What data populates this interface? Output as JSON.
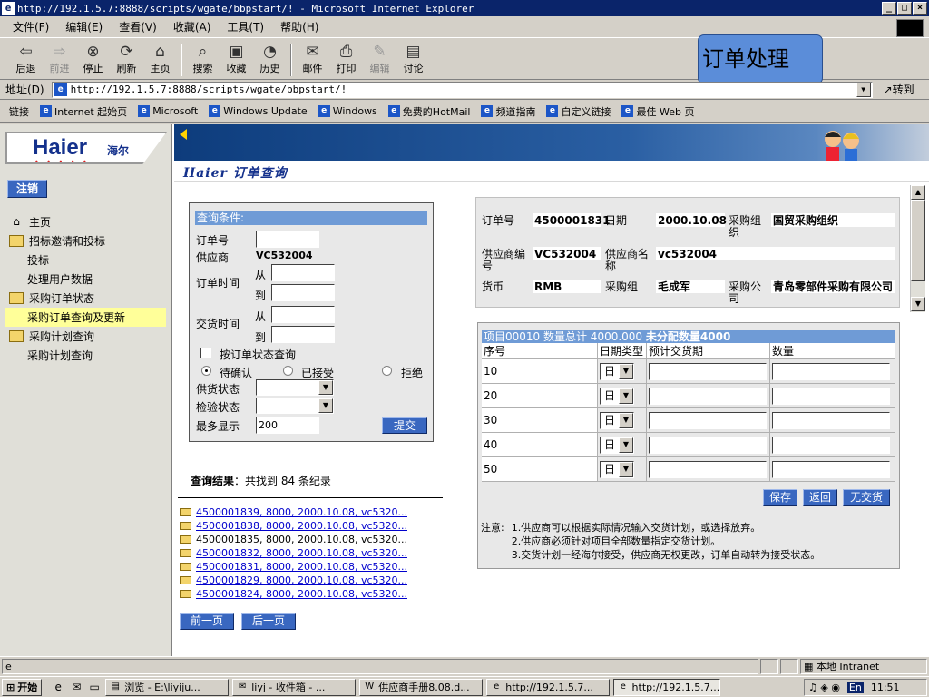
{
  "window": {
    "title": "http://192.1.5.7:8888/scripts/wgate/bbpstart/! - Microsoft Internet Explorer"
  },
  "menu": [
    "文件(F)",
    "编辑(E)",
    "查看(V)",
    "收藏(A)",
    "工具(T)",
    "帮助(H)"
  ],
  "toolbar": {
    "back": "后退",
    "forward": "前进",
    "stop": "停止",
    "refresh": "刷新",
    "home": "主页",
    "search": "搜索",
    "favorites": "收藏",
    "history": "历史",
    "mail": "邮件",
    "print": "打印",
    "edit": "编辑",
    "discuss": "讨论"
  },
  "overlay_label": "订单处理",
  "address": {
    "label": "地址(D)",
    "url": "http://192.1.5.7:8888/scripts/wgate/bbpstart/!",
    "go": "转到"
  },
  "links": {
    "label": "链接",
    "items": [
      "Internet 起始页",
      "Microsoft",
      "Windows Update",
      "Windows",
      "免费的HotMail",
      "频道指南",
      "自定义链接",
      "最佳 Web 页"
    ]
  },
  "brand": {
    "name": "Haier",
    "cn": "海尔"
  },
  "logout": "注销",
  "nav": [
    {
      "label": "主页",
      "kind": "home"
    },
    {
      "label": "招标邀请和投标",
      "kind": "folder"
    },
    {
      "label": "投标",
      "kind": "sub"
    },
    {
      "label": "处理用户数据",
      "kind": "sub"
    },
    {
      "label": "采购订单状态",
      "kind": "folder"
    },
    {
      "label": "采购订单查询及更新",
      "kind": "sub",
      "selected": true
    },
    {
      "label": "采购计划查询",
      "kind": "folder"
    },
    {
      "label": "采购计划查询",
      "kind": "sub"
    }
  ],
  "page_title": "Haier 订单查询",
  "query": {
    "header": "查询条件:",
    "order_no_label": "订单号",
    "supplier_label": "供应商",
    "supplier_value": "VC532004",
    "order_time_label": "订单时间",
    "from": "从",
    "to": "到",
    "delivery_time_label": "交货时间",
    "status_check_label": "按订单状态查询",
    "radio_pending": "待确认",
    "radio_accepted": "已接受",
    "radio_rejected": "拒绝",
    "supply_status_label": "供货状态",
    "inspect_status_label": "检验状态",
    "max_label": "最多显示",
    "max_value": "200",
    "submit": "提交"
  },
  "results": {
    "label": "查询结果",
    "summary": "：共找到 84 条纪录",
    "items": [
      {
        "text": "4500001839, 8000, 2000.10.08, vc5320...",
        "link": true
      },
      {
        "text": "4500001838, 8000, 2000.10.08, vc5320...",
        "link": true
      },
      {
        "text": "4500001835, 8000, 2000.10.08, vc5320...",
        "link": false
      },
      {
        "text": "4500001832, 8000, 2000.10.08, vc5320...",
        "link": true
      },
      {
        "text": "4500001831, 8000, 2000.10.08, vc5320...",
        "link": true
      },
      {
        "text": "4500001829, 8000, 2000.10.08, vc5320...",
        "link": true
      },
      {
        "text": "4500001824, 8000, 2000.10.08, vc5320...",
        "link": true
      }
    ],
    "prev": "前一页",
    "next": "后一页"
  },
  "order": {
    "order_no_label": "订单号",
    "order_no": "4500001831",
    "date_label": "日期",
    "date": "2000.10.08",
    "purch_group_org_label": "采购组织",
    "purch_org": "国贸采购组织",
    "supplier_no_label": "供应商编号",
    "supplier_no": "VC532004",
    "supplier_name_label": "供应商名称",
    "supplier_name": "vc532004",
    "currency_label": "货币",
    "currency": "RMB",
    "purch_group_label": "采购组",
    "purch_group": "毛成军",
    "company_label": "采购公司",
    "company": "青岛零部件采购有限公司"
  },
  "plan": {
    "header_item": "项目00010 数量总计 4000.000",
    "header_unalloc": "未分配数量4000",
    "cols": [
      "序号",
      "日期类型",
      "预计交货期",
      "数量"
    ],
    "rows": [
      {
        "seq": "10",
        "type": "日"
      },
      {
        "seq": "20",
        "type": "日"
      },
      {
        "seq": "30",
        "type": "日"
      },
      {
        "seq": "40",
        "type": "日"
      },
      {
        "seq": "50",
        "type": "日"
      }
    ],
    "save": "保存",
    "back": "返回",
    "no_delivery": "无交货"
  },
  "notes": {
    "label": "注意:",
    "lines": [
      "1.供应商可以根据实际情况输入交货计划，或选择放弃。",
      "2.供应商必须针对项目全部数量指定交货计划。",
      "3.交货计划一经海尔接受，供应商无权更改，订单自动转为接受状态。"
    ]
  },
  "status": {
    "zone": "本地 Intranet"
  },
  "taskbar": {
    "start": "开始",
    "tasks": [
      {
        "label": "浏览 - E:\\liyiju...",
        "active": false
      },
      {
        "label": "liyj - 收件箱 - ...",
        "active": false
      },
      {
        "label": "供应商手册8.08.d...",
        "active": false
      },
      {
        "label": "http://192.1.5.7...",
        "active": false
      },
      {
        "label": "http://192.1.5.7...",
        "active": true
      }
    ],
    "lang": "En",
    "clock": "11:51"
  }
}
